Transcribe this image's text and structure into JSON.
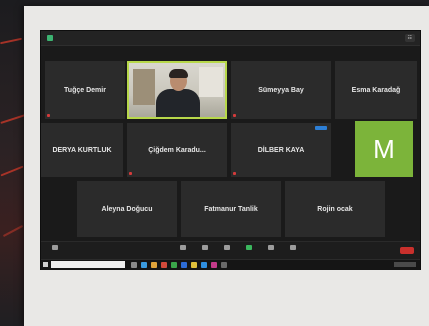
{
  "meeting": {
    "participants": [
      {
        "id": "tugce",
        "name": "Tuğçe Demir"
      },
      {
        "id": "sumeyya",
        "name": "Sümeyya Bay"
      },
      {
        "id": "esma",
        "name": "Esma Karadağ"
      },
      {
        "id": "derya",
        "name": "DERYA KURTLUK"
      },
      {
        "id": "cigdem",
        "name": "Çiğdem Karadu..."
      },
      {
        "id": "dilber",
        "name": "DİLBER KAYA"
      },
      {
        "id": "aleyna",
        "name": "Aleyna Doğucu"
      },
      {
        "id": "fatmanur",
        "name": "Fatmanur Tanlik"
      },
      {
        "id": "rojin",
        "name": "Rojin ocak"
      }
    ],
    "avatar_letter": "M",
    "avatar_color": "#7cb43a",
    "active_speaker_border": "#b7d84a",
    "end_button_color": "#c9302c"
  }
}
